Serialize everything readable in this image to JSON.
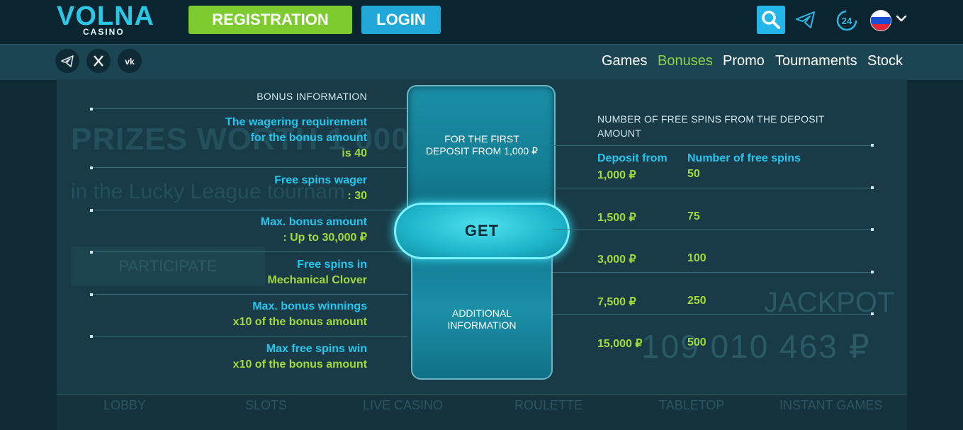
{
  "header": {
    "logo_main": "VOLNA",
    "logo_sub": "CASINO",
    "register_label": "REGISTRATION",
    "login_label": "LOGIN",
    "support_badge": "24",
    "flag_colors": [
      "#ffffff",
      "#1a4fd1",
      "#e32636"
    ]
  },
  "nav": {
    "items": [
      {
        "label": "Games",
        "active": false
      },
      {
        "label": "Bonuses",
        "active": true
      },
      {
        "label": "Promo",
        "active": false
      },
      {
        "label": "Tournaments",
        "active": false
      },
      {
        "label": "Stock",
        "active": false
      }
    ],
    "social": [
      "telegram-icon",
      "x-icon",
      "vk-icon"
    ]
  },
  "background": {
    "prize_text": "PRIZES WORTH 1 000",
    "league_text": "in the Lucky League tournam",
    "participate": "PARTICIPATE",
    "jackpot": "JACKPOT",
    "jackpot_amount": "109 010 463 ₽",
    "tabs": [
      "LOBBY",
      "SLOTS",
      "LIVE CASINO",
      "ROULETTE",
      "TABLETOP",
      "INSTANT GAMES"
    ]
  },
  "bonus_info": {
    "heading": "BONUS INFORMATION",
    "rows": [
      {
        "label": "The wagering requirement for the bonus amount",
        "value": "is 40"
      },
      {
        "label": "Free spins wager",
        "value": ": 30"
      },
      {
        "label": "Max. bonus amount",
        "value": ": Up to 30,000 ₽"
      },
      {
        "label": "Free spins in",
        "value": "Mechanical Clover"
      },
      {
        "label": "Max. bonus winnings",
        "value": "x10 of the bonus amount"
      },
      {
        "label": "Max free spins win",
        "value": "x10 of the bonus amount"
      }
    ]
  },
  "card": {
    "top_line1": "FOR THE FIRST",
    "top_line2": "DEPOSIT FROM  1,000 ₽",
    "get_label": "GET",
    "bottom_line1": "ADDITIONAL",
    "bottom_line2": "INFORMATION"
  },
  "free_spins": {
    "heading": "NUMBER OF FREE SPINS FROM THE DEPOSIT AMOUNT",
    "col_deposit": "Deposit from",
    "col_spins": "Number of free spins",
    "rows": [
      {
        "deposit": "1,000 ₽",
        "spins": "50"
      },
      {
        "deposit": "1,500 ₽",
        "spins": "75"
      },
      {
        "deposit": "3,000 ₽",
        "spins": "100"
      },
      {
        "deposit": "7,500 ₽",
        "spins": "250"
      },
      {
        "deposit": "15,000 ₽",
        "spins": "500"
      }
    ]
  }
}
